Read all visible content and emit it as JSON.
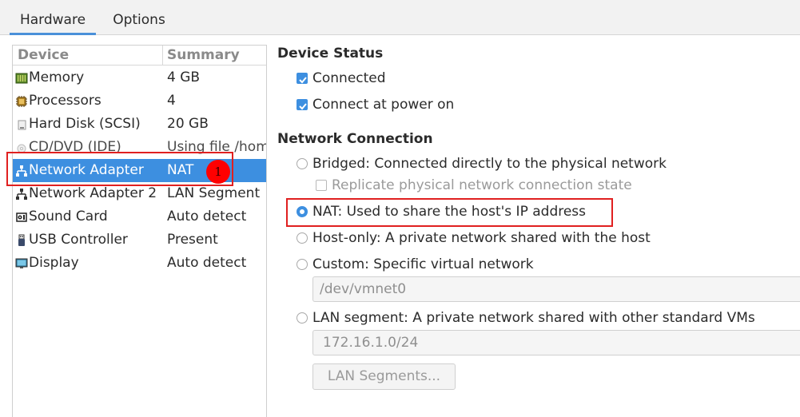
{
  "tabs": [
    {
      "label": "Hardware",
      "active": true
    },
    {
      "label": "Options",
      "active": false
    }
  ],
  "device_list": {
    "headers": {
      "device": "Device",
      "summary": "Summary"
    },
    "rows": [
      {
        "icon": "memory-icon",
        "name": "Memory",
        "summary": "4 GB"
      },
      {
        "icon": "processor-icon",
        "name": "Processors",
        "summary": "4"
      },
      {
        "icon": "hard-disk-icon",
        "name": "Hard Disk (SCSI)",
        "summary": "20 GB"
      },
      {
        "icon": "cd-dvd-icon",
        "name": "CD/DVD (IDE)",
        "summary": "Using file /hom"
      },
      {
        "icon": "network-icon",
        "name": "Network Adapter",
        "summary": "NAT",
        "selected": true
      },
      {
        "icon": "network-icon",
        "name": "Network Adapter 2",
        "summary": "LAN Segment"
      },
      {
        "icon": "sound-icon",
        "name": "Sound Card",
        "summary": "Auto detect"
      },
      {
        "icon": "usb-icon",
        "name": "USB Controller",
        "summary": "Present"
      },
      {
        "icon": "display-icon",
        "name": "Display",
        "summary": "Auto detect"
      }
    ]
  },
  "device_status": {
    "title": "Device Status",
    "connected": {
      "label": "Connected",
      "checked": true
    },
    "connect_at_power_on": {
      "label": "Connect at power on",
      "checked": true
    }
  },
  "network_connection": {
    "title": "Network Connection",
    "bridged": {
      "label": "Bridged: Connected directly to the physical network",
      "selected": false
    },
    "replicate": {
      "label": "Replicate physical network connection state",
      "checked": false,
      "enabled": false
    },
    "nat": {
      "label": "NAT: Used to share the host's IP address",
      "selected": true
    },
    "host_only": {
      "label": "Host-only: A private network shared with the host",
      "selected": false
    },
    "custom": {
      "label": "Custom: Specific virtual network",
      "selected": false
    },
    "custom_network_value": "/dev/vmnet0",
    "lan_segment": {
      "label": "LAN segment: A private network shared with other standard VMs",
      "selected": false
    },
    "lan_segment_value": "172.16.1.0/24",
    "lan_segments_button": "LAN Segments..."
  },
  "annotations": {
    "badge_number": "1",
    "highlight_color": "#e02020"
  },
  "colors": {
    "accent": "#3d8fe0"
  }
}
